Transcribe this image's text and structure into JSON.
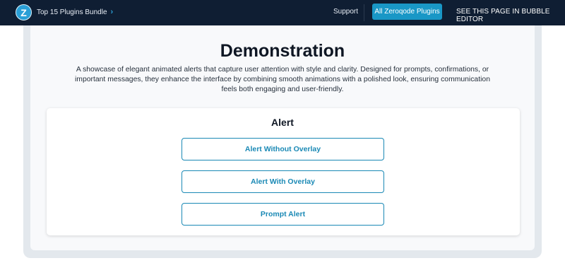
{
  "header": {
    "logo_letter": "Z",
    "bundle_label": "Top 15 Plugins Bundle",
    "bundle_chevron": "›",
    "support_label": "Support",
    "plugins_label": "All Zeroqode Plugins",
    "bubble_editor_label": "SEE THIS PAGE IN BUBBLE EDITOR"
  },
  "main": {
    "title": "Demonstration",
    "description": "A showcase of elegant animated alerts that capture user attention with style and clarity. Designed for prompts, confirmations, or important messages, they enhance the interface by combining smooth animations with a polished look, ensuring communication feels both engaging and user-friendly."
  },
  "alert_panel": {
    "title": "Alert",
    "buttons": [
      "Alert Without Overlay",
      "Alert With Overlay",
      "Prompt Alert"
    ]
  },
  "colors": {
    "header_bg": "#0f1e33",
    "accent": "#1997c6",
    "button_border": "#1a89b5"
  }
}
